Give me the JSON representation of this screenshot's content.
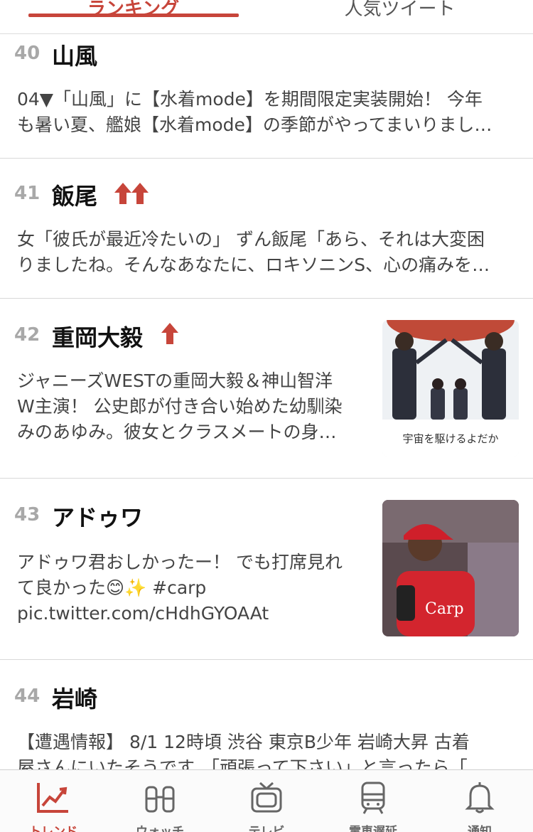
{
  "tabs": [
    {
      "label": "ランキング",
      "active": true
    },
    {
      "label": "人気ツイート",
      "active": false
    }
  ],
  "items": [
    {
      "rank": "40",
      "title": "山風",
      "arrows": 0,
      "line1": "04▼「山風」に【水着mode】を期間限定実装開始！ 今年",
      "line2": "も暑い夏、艦娘【水着mode】の季節がやってまいりまし…"
    },
    {
      "rank": "41",
      "title": "飯尾",
      "arrows": 2,
      "line1": "女「彼氏が最近冷たいの」 ずん飯尾「あら、それは大変困",
      "line2": "りましたね。そんなあなたに、ロキソニンS、心の痛みを…"
    },
    {
      "rank": "42",
      "title": "重岡大毅",
      "arrows": 1,
      "line1": "ジャニーズWESTの重岡大毅＆神山智洋",
      "line2": "W主演！ 公史郎が付き合い始めた幼馴染",
      "line3": "みのあゆみ。彼女とクラスメートの身…",
      "thumb_caption": "宇宙を駆けるよだか"
    },
    {
      "rank": "43",
      "title": "アドゥワ",
      "arrows": 0,
      "line1": "アドゥワ君おしかったー！ でも打席見れ",
      "line2": "て良かった😊✨  #carp",
      "line3": "pic.twitter.com/cHdhGYOAAt"
    },
    {
      "rank": "44",
      "title": "岩崎",
      "arrows": 0,
      "line1": "【遭遇情報】 8/1 12時頃 渋谷 東京B少年 岩崎大昇 古着",
      "line2": "屋さんにいたそうです。「頑張って下さい」と言ったら「…"
    }
  ],
  "nav": [
    {
      "label": "トレンド",
      "icon": "trend-chart-icon",
      "active": true
    },
    {
      "label": "ウォッチ",
      "icon": "binoculars-icon",
      "active": false
    },
    {
      "label": "テレビ",
      "icon": "tv-icon",
      "active": false
    },
    {
      "label": "電車遅延",
      "icon": "train-icon",
      "active": false
    },
    {
      "label": "通知",
      "icon": "bell-icon",
      "active": false
    }
  ],
  "colors": {
    "accent": "#c7453a",
    "rank": "#a8a8a8",
    "divider": "#d8d8d8"
  }
}
